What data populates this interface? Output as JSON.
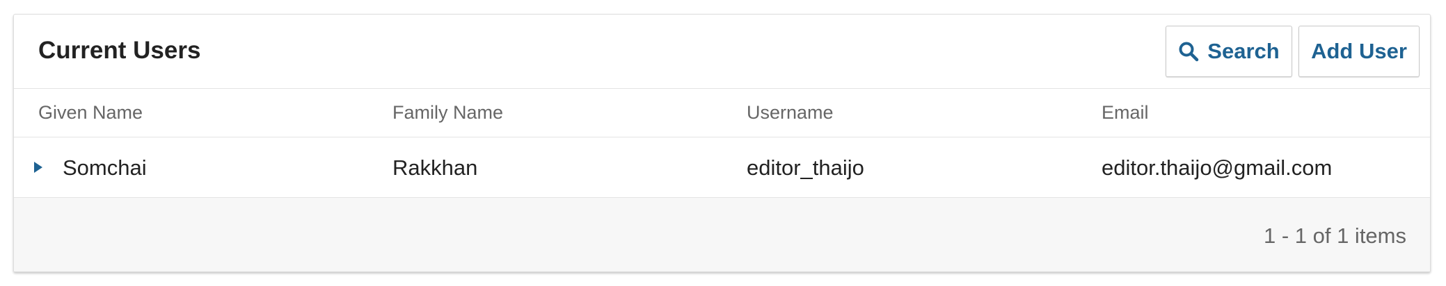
{
  "panel": {
    "title": "Current Users",
    "search_button_label": "Search",
    "add_user_button_label": "Add User"
  },
  "table": {
    "columns": [
      "Given Name",
      "Family Name",
      "Username",
      "Email"
    ],
    "rows": [
      {
        "given_name": "Somchai",
        "family_name": "Rakkhan",
        "username": "editor_thaijo",
        "email": "editor.thaijo@gmail.com"
      }
    ]
  },
  "footer": {
    "pagination": "1 - 1 of 1 items"
  },
  "colors": {
    "accent": "#1e6292",
    "text": "#222222",
    "muted": "#666666",
    "border": "#dddddd",
    "footer_bg": "#f7f7f7"
  },
  "icons": {
    "search": "search-icon",
    "expand": "caret-right-icon"
  }
}
